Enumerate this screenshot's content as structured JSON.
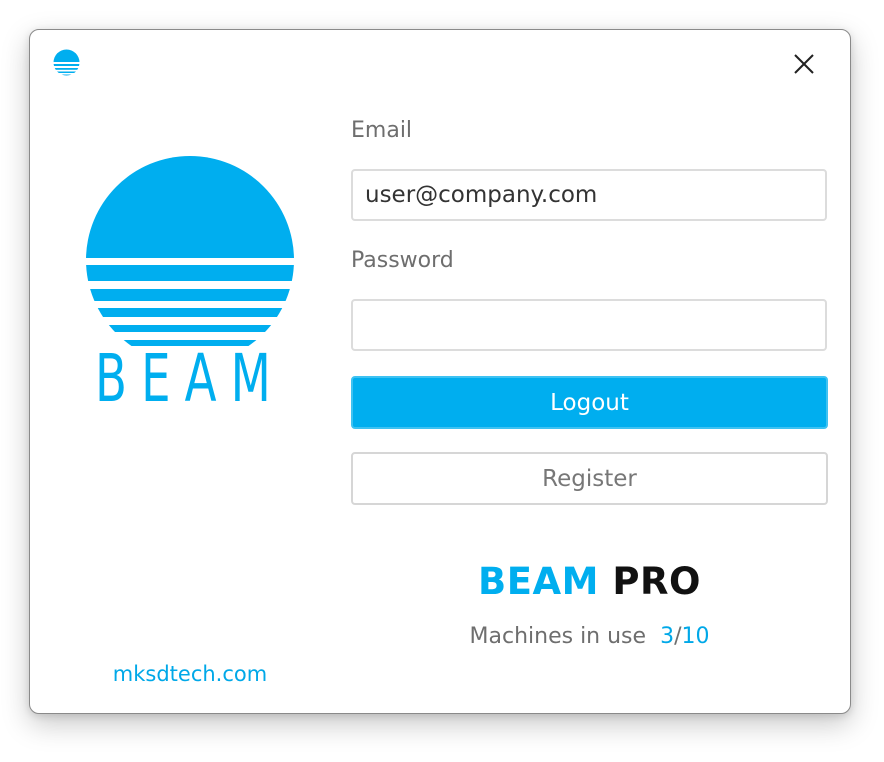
{
  "window": {
    "app_icon": "beam-sun-icon",
    "close_icon": "close-icon"
  },
  "logo": {
    "icon": "beam-logo",
    "text": "BEAM",
    "color": "#00aeef"
  },
  "form": {
    "email_label": "Email",
    "email_value": "user@company.com",
    "password_label": "Password",
    "password_value": "",
    "logout_label": "Logout",
    "register_label": "Register"
  },
  "product": {
    "brand": "BEAM",
    "tier": "PRO"
  },
  "usage": {
    "label": "Machines in use",
    "used": "3",
    "separator": "/",
    "total": "10"
  },
  "footer": {
    "link_text": "mksdtech.com"
  },
  "colors": {
    "accent": "#00aeef",
    "text_muted": "#6e6e6e"
  }
}
